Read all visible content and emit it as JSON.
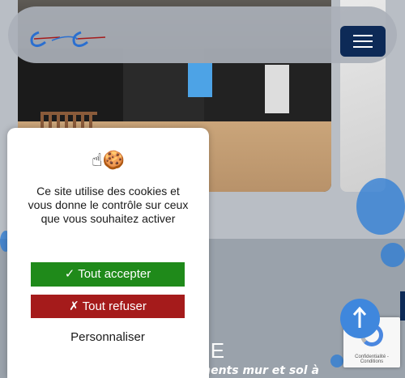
{
  "header": {
    "logo_alt": "logo",
    "menu_label": ""
  },
  "hero": {
    "heading": "RE",
    "subline": "ements mur et sol à"
  },
  "cookie_banner": {
    "icons": [
      "pointing-hand-icon",
      "cookie-icon"
    ],
    "emoji": "☝🍪",
    "text": "Ce site utilise des cookies et vous donne le contrôle sur ceux que vous souhaitez activer",
    "accept_label": "✓ Tout accepter",
    "refuse_label": "✗ Tout refuser",
    "customize_label": "Personnaliser"
  },
  "recaptcha": {
    "terms": "Confidentialité - Conditions"
  },
  "colors": {
    "navy": "#0d2a57",
    "accept": "#1f8a1a",
    "refuse": "#a51b1b",
    "accent_blue": "#3f87dd"
  }
}
